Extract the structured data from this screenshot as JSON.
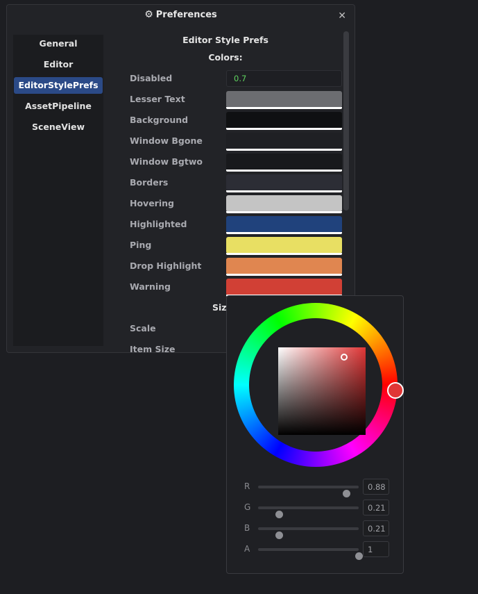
{
  "window": {
    "title": "Preferences",
    "title_icon": "gear-icon",
    "close_icon": "close-icon"
  },
  "sidebar": {
    "items": [
      {
        "label": "General",
        "active": false
      },
      {
        "label": "Editor",
        "active": false
      },
      {
        "label": "EditorStylePrefs",
        "active": true
      },
      {
        "label": "AssetPipeline",
        "active": false
      },
      {
        "label": "SceneView",
        "active": false
      }
    ]
  },
  "main": {
    "heading": "Editor Style Prefs",
    "colors_heading": "Colors:",
    "disabled_label": "Disabled",
    "disabled_value": "0.7",
    "color_rows": [
      {
        "label": "Lesser Text",
        "color": "#6c6d71"
      },
      {
        "label": "Background",
        "color": "#0f1012"
      },
      {
        "label": "Window Bgone",
        "color": "#1f2024"
      },
      {
        "label": "Window Bgtwo",
        "color": "#18191c"
      },
      {
        "label": "Borders",
        "color": "#2c2d35"
      },
      {
        "label": "Hovering",
        "color": "#c4c4c4"
      },
      {
        "label": "Highlighted",
        "color": "#20427c"
      },
      {
        "label": "Ping",
        "color": "#e8df63"
      },
      {
        "label": "Drop Highlight",
        "color": "#e08650"
      },
      {
        "label": "Warning",
        "color": "#d14035"
      }
    ],
    "sizing_heading": "Sizi",
    "size_rows": [
      {
        "label": "Scale"
      },
      {
        "label": "Item Size"
      }
    ]
  },
  "color_picker": {
    "current_color": "#e03636",
    "channels": [
      {
        "label": "R",
        "value": "0.88",
        "fraction": 0.88
      },
      {
        "label": "G",
        "value": "0.21",
        "fraction": 0.21
      },
      {
        "label": "B",
        "value": "0.21",
        "fraction": 0.21
      },
      {
        "label": "A",
        "value": "1",
        "fraction": 1.0
      }
    ]
  }
}
